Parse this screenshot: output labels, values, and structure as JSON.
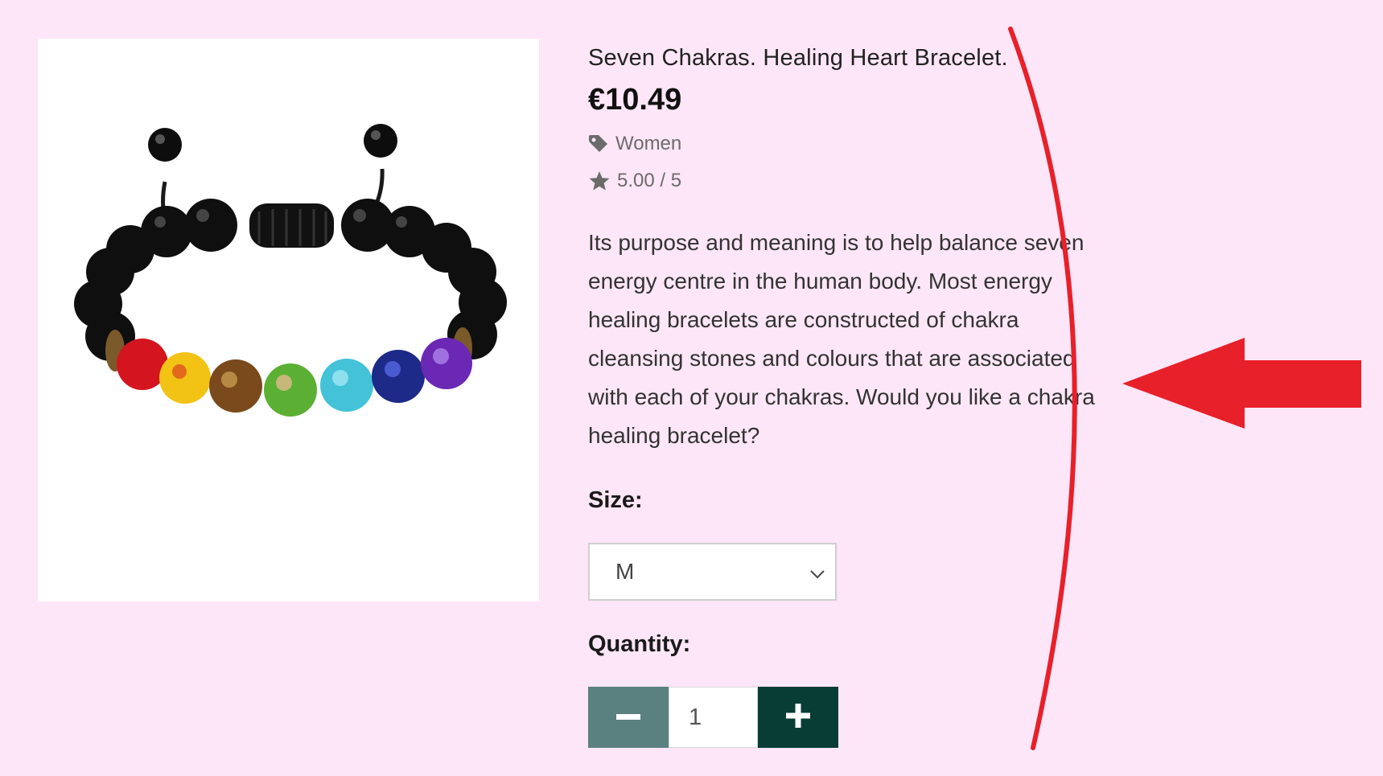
{
  "product": {
    "title": "Seven Chakras. Healing Heart Bracelet.",
    "price": "€10.49",
    "category": "Women",
    "rating": "5.00 / 5",
    "description": "Its purpose and meaning is to help balance seven energy centre in the human body. Most energy healing bracelets are constructed of chakra cleansing stones and colours that are associated with each of your chakras. Would you like a chakra healing bracelet?",
    "image_icon": "bracelet-image"
  },
  "size": {
    "label": "Size:",
    "selected": "M"
  },
  "quantity": {
    "label": "Quantity:",
    "value": "1"
  },
  "icons": {
    "category": "tag-icon",
    "rating": "star-icon",
    "select": "chevron-down-icon",
    "decrease": "minus-icon",
    "increase": "plus-icon"
  },
  "colors": {
    "background": "#fde6f7",
    "minus_button": "#5b8080",
    "plus_button": "#083d36",
    "annotation": "#e8202a"
  }
}
